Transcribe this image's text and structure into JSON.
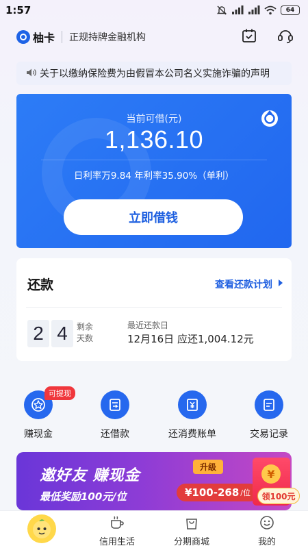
{
  "status_bar": {
    "time": "1:57",
    "battery": "64"
  },
  "header": {
    "logo_text": "柚卡",
    "tagline": "正规持牌金融机构"
  },
  "notice": {
    "text": "关于以缴纳保险费为由假冒本公司名义实施诈骗的声明"
  },
  "loan_card": {
    "label": "当前可借(元)",
    "amount": "1,136.10",
    "rate_text": "日利率万9.84 年利率35.90%（单利）",
    "button_label": "立即借钱"
  },
  "repayment": {
    "title": "还款",
    "plan_link": "查看还款计划",
    "days_digits": [
      "2",
      "4"
    ],
    "days_label_top": "剩余",
    "days_label_bottom": "天数",
    "recent_label": "最近还款日",
    "recent_value": "12月16日  应还1,004.12元"
  },
  "quick_actions": [
    {
      "label": "赚现金",
      "icon": "star-badge-icon",
      "tag": "可提现"
    },
    {
      "label": "还借款",
      "icon": "repay-card-icon"
    },
    {
      "label": "还消费账单",
      "icon": "yen-bill-icon"
    },
    {
      "label": "交易记录",
      "icon": "record-list-icon"
    }
  ],
  "promo": {
    "title": "邀好友 赚现金",
    "subtitle": "最低奖励100元/位",
    "upgrade": "升级",
    "range": "¥100-268",
    "range_suffix": "/位",
    "get_button": "领100元",
    "coin_symbol": "¥"
  },
  "bottom_nav": [
    {
      "label": "",
      "icon": "mascot-home-icon"
    },
    {
      "label": "信用生活",
      "icon": "coffee-cup-icon"
    },
    {
      "label": "分期商城",
      "icon": "shopping-bag-icon"
    },
    {
      "label": "我的",
      "icon": "smile-face-icon"
    }
  ],
  "colors": {
    "brand_blue": "#2167ef",
    "link_blue": "#1f5fe0",
    "tag_red": "#f0373c",
    "promo_purple": "#7a39d7"
  }
}
